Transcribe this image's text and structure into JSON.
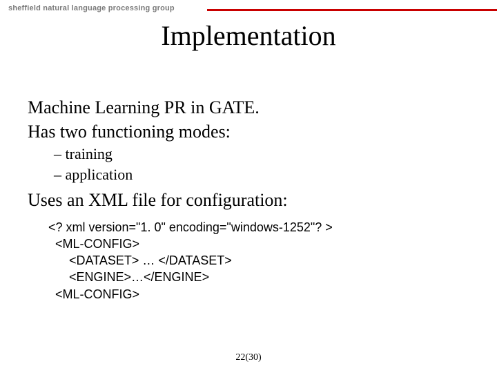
{
  "header": {
    "brand": "sheffield natural language processing group"
  },
  "title": "Implementation",
  "body": {
    "line1": "Machine Learning PR in GATE.",
    "line2": "Has two functioning modes:",
    "mode1": "– training",
    "mode2": "– application",
    "line3": "Uses an XML file for configuration:"
  },
  "xml": {
    "l1": "<? xml version=\"1. 0\" encoding=\"windows-1252\"? >",
    "l2": "  <ML-CONFIG>",
    "l3": "      <DATASET> … </DATASET>",
    "l4": "      <ENGINE>…</ENGINE>",
    "l5": "  <ML-CONFIG>"
  },
  "pagenum": "22(30)"
}
